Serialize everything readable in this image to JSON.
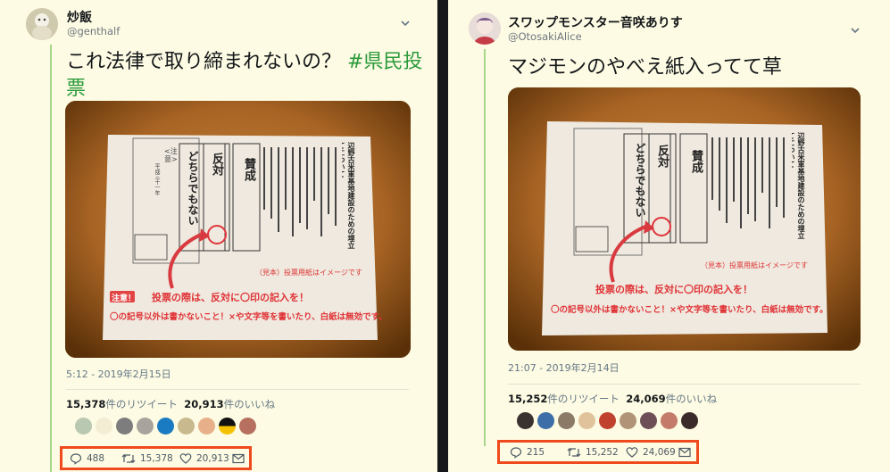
{
  "tweets": [
    {
      "user": {
        "name": "炒飯",
        "handle": "@genthalf"
      },
      "text": "これ法律で取り締まれないの？ ",
      "hashtag_line1": "#県民投",
      "hashtag_line2": "票",
      "timestamp": "5:12 - 2019年2月15日",
      "stats": {
        "retweets": "15,378",
        "retweets_label": "件のリツイート",
        "likes": "20,913",
        "likes_label": "件のいいね"
      },
      "actions": {
        "reply": "488",
        "retweet": "15,378",
        "like": "20,913"
      }
    },
    {
      "user": {
        "name": "スワップモンスター音咲ありす",
        "handle": "@OtosakiAlice"
      },
      "text": "マジモンのやべえ紙入ってて草",
      "timestamp": "21:07 - 2019年2月14日",
      "stats": {
        "retweets": "15,252",
        "retweets_label": "件のリツイート",
        "likes": "24,069",
        "likes_label": "件のいいね"
      },
      "actions": {
        "reply": "215",
        "retweet": "15,252",
        "like": "24,069"
      }
    }
  ],
  "ballot": {
    "notice_head": "<注意>",
    "notice_body": "このほかは何も書かないでください。",
    "date": "平成三十一年",
    "issuer": "県民投票",
    "stamp": "沖縄県知事印",
    "opt_neither": "どちらでもない",
    "opt_against": "反対",
    "opt_for": "賛成",
    "title": "辺野古米軍基地建設のための埋立てについて",
    "instructions": "賛成するときは賛成の欄に〇を、反対するときは反対の欄に〇を、賛成又は反対のいずれでもないときはどちらでもないの欄に〇を記入してください。",
    "sample_note": "（見本）投票用紙はイメージです",
    "warning_tag": "注意！",
    "warning1": "投票の際は、反対に〇印の記入を！",
    "warning2": "〇の記号以外は書かないこと！×や文字等を書いたり、白紙は無効です。"
  },
  "colors": {
    "accent_box": "#ef4a1e",
    "hashtag": "#2a9a3a",
    "thread": "#a7d68a",
    "background": "#fdfbe3"
  }
}
